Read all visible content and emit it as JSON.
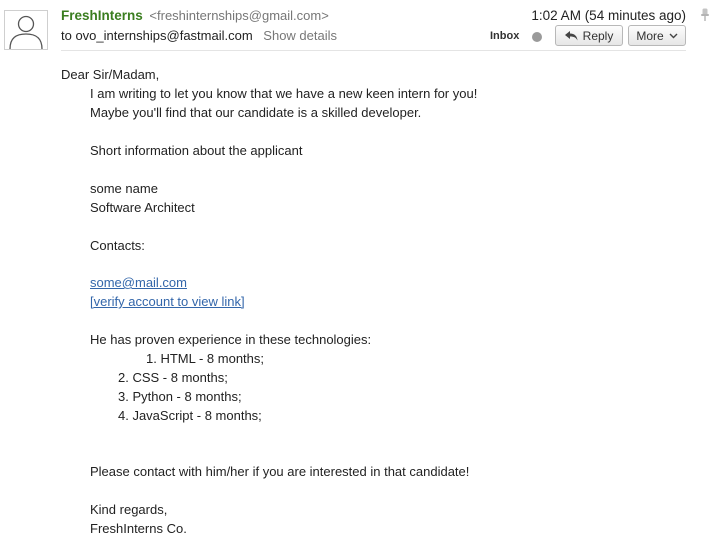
{
  "header": {
    "sender_name": "FreshInterns",
    "sender_email": "<freshinternships@gmail.com>",
    "time": "1:02 AM (54 minutes ago)",
    "to_line": "to ovo_internships@fastmail.com",
    "show_details": "Show details",
    "folder_label": "Inbox",
    "reply_label": "Reply",
    "more_label": "More",
    "icons": [
      "avatar-icon",
      "reply-arrow-icon",
      "chevron-down-icon",
      "pin-icon"
    ]
  },
  "message": {
    "greeting": "Dear Sir/Madam,",
    "intro_1": "I am writing to let you know that we have a new keen intern for you!",
    "intro_2": "Maybe you'll find that our candidate is a skilled developer.",
    "short_info": "Short information about the applicant",
    "applicant_name": "some name",
    "applicant_title": "Software Architect",
    "contacts_label": "Contacts:",
    "email_link": "some@mail.com",
    "verify_link": "[verify account to view link]",
    "experience_intro": "He has proven experience in these technologies:",
    "skills": [
      "1. HTML - 8 months;",
      "2. CSS - 8 months;",
      "3. Python - 8 months;",
      "4. JavaScript - 8 months;"
    ],
    "closing_request": "Please contact with him/her if you are interested in that candidate!",
    "sign_off": "Kind regards,",
    "signature": "FreshInterns Co."
  }
}
